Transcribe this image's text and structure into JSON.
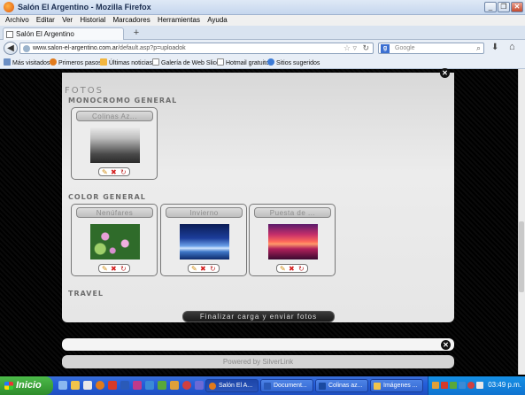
{
  "window": {
    "title": "Salón El Argentino - Mozilla Firefox"
  },
  "menu": [
    "Archivo",
    "Editar",
    "Ver",
    "Historial",
    "Marcadores",
    "Herramientas",
    "Ayuda"
  ],
  "tab": {
    "label": "Salón El Argentino",
    "new_tab": "+"
  },
  "nav": {
    "url_domain": "www.salon-el-argentino.com.ar",
    "url_path": "/default.asp?p=uploadok",
    "search_placeholder": "Google"
  },
  "bookmarks": [
    "Más visitados",
    "Primeros pasos",
    "Últimas noticias",
    "Galería de Web Slice",
    "Hotmail gratuito",
    "Sitios sugeridos"
  ],
  "page": {
    "heading": "FOTOS",
    "sections": [
      {
        "title": "MONOCROMO GENERAL",
        "photos": [
          "Colinas Az..."
        ]
      },
      {
        "title": "COLOR GENERAL",
        "photos": [
          "Nenúfares",
          "Invierno",
          "Puesta de ..."
        ]
      },
      {
        "title": "TRAVEL",
        "photos": []
      }
    ],
    "finalize_button": "Finalizar carga y enviar fotos",
    "footer": "Powered by SilverLink"
  },
  "taskbar": {
    "start": "Inicio",
    "tasks": [
      "Salón El A...",
      "Document...",
      "Colinas az...",
      "Imágenes ..."
    ],
    "clock": "03:49 p.m."
  }
}
